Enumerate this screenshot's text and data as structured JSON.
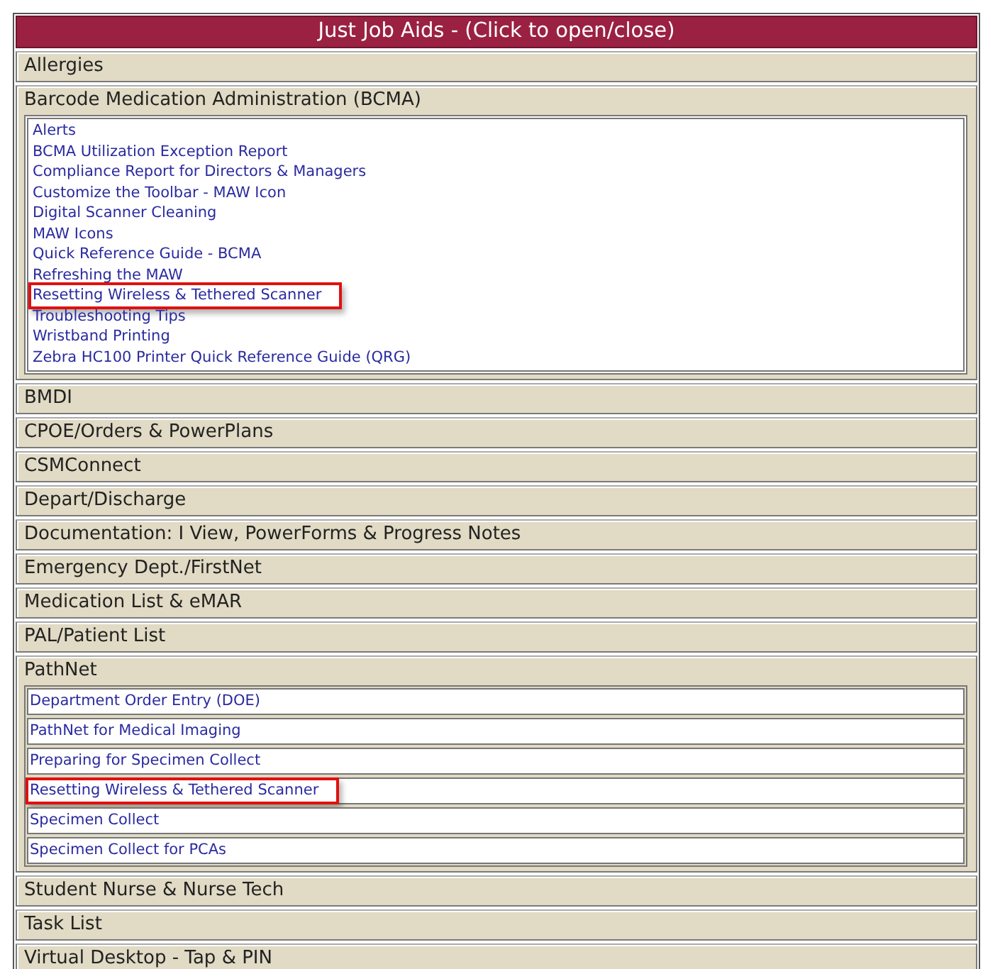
{
  "title": "Just Job Aids - (Click to open/close)",
  "sections": [
    {
      "label": "Allergies"
    },
    {
      "label": "Barcode Medication Administration (BCMA)",
      "kind": "list",
      "items": [
        {
          "label": "Alerts",
          "highlighted": false
        },
        {
          "label": "BCMA Utilization Exception Report",
          "highlighted": false
        },
        {
          "label": "Compliance Report for Directors & Managers",
          "highlighted": false
        },
        {
          "label": "Customize the Toolbar - MAW Icon",
          "highlighted": false
        },
        {
          "label": "Digital Scanner Cleaning",
          "highlighted": false
        },
        {
          "label": "MAW Icons",
          "highlighted": false
        },
        {
          "label": "Quick Reference Guide - BCMA",
          "highlighted": false
        },
        {
          "label": "Refreshing the MAW",
          "highlighted": false
        },
        {
          "label": "Resetting Wireless & Tethered Scanner",
          "highlighted": true
        },
        {
          "label": "Troubleshooting Tips",
          "highlighted": false
        },
        {
          "label": "Wristband Printing",
          "highlighted": false
        },
        {
          "label": "Zebra HC100 Printer Quick Reference Guide (QRG)",
          "highlighted": false
        }
      ]
    },
    {
      "label": "BMDI"
    },
    {
      "label": "CPOE/Orders & PowerPlans"
    },
    {
      "label": "CSMConnect"
    },
    {
      "label": "Depart/Discharge"
    },
    {
      "label": "Documentation: I View, PowerForms & Progress Notes"
    },
    {
      "label": "Emergency Dept./FirstNet"
    },
    {
      "label": "Medication List & eMAR"
    },
    {
      "label": "PAL/Patient List"
    },
    {
      "label": "PathNet",
      "kind": "boxed",
      "items": [
        {
          "label": "Department Order Entry (DOE)",
          "highlighted": false
        },
        {
          "label": "PathNet for Medical Imaging",
          "highlighted": false
        },
        {
          "label": "Preparing for Specimen Collect",
          "highlighted": false
        },
        {
          "label": "Resetting Wireless & Tethered Scanner",
          "highlighted": true
        },
        {
          "label": "Specimen Collect",
          "highlighted": false
        },
        {
          "label": "Specimen Collect for PCAs",
          "highlighted": false
        }
      ]
    },
    {
      "label": "Student Nurse & Nurse Tech"
    },
    {
      "label": "Task List"
    },
    {
      "label": "Virtual Desktop - Tap & PIN"
    }
  ]
}
